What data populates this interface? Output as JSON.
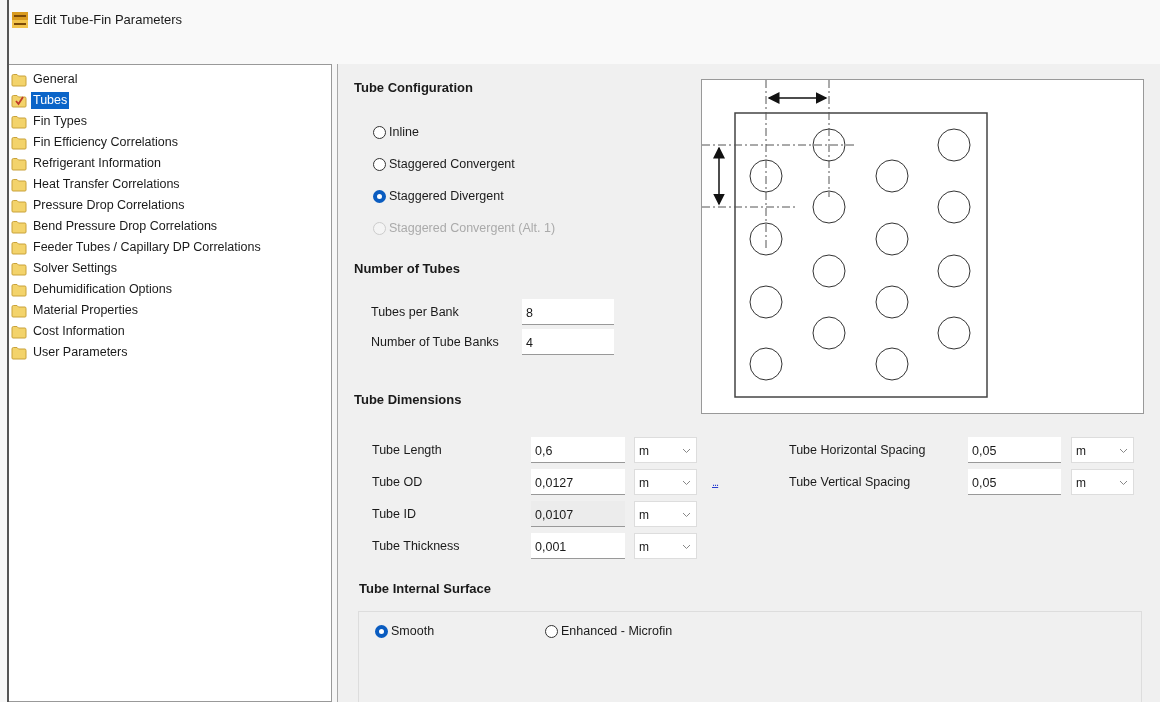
{
  "window": {
    "title": "Edit Tube-Fin Parameters"
  },
  "sidebar": {
    "items": [
      {
        "label": "General",
        "selected": false
      },
      {
        "label": "Tubes",
        "selected": true
      },
      {
        "label": "Fin Types",
        "selected": false
      },
      {
        "label": "Fin Efficiency Correlations",
        "selected": false
      },
      {
        "label": "Refrigerant Information",
        "selected": false
      },
      {
        "label": "Heat Transfer Correlations",
        "selected": false
      },
      {
        "label": "Pressure Drop Correlations",
        "selected": false
      },
      {
        "label": "Bend Pressure Drop Correlations",
        "selected": false
      },
      {
        "label": "Feeder Tubes / Capillary DP Correlations",
        "selected": false
      },
      {
        "label": "Solver Settings",
        "selected": false
      },
      {
        "label": "Dehumidification Options",
        "selected": false
      },
      {
        "label": "Material Properties",
        "selected": false
      },
      {
        "label": "Cost Information",
        "selected": false
      },
      {
        "label": "User Parameters",
        "selected": false
      }
    ]
  },
  "tube_configuration": {
    "title": "Tube Configuration",
    "options": [
      {
        "label": "Inline",
        "selected": false,
        "disabled": false
      },
      {
        "label": "Staggered Convergent",
        "selected": false,
        "disabled": false
      },
      {
        "label": "Staggered Divergent",
        "selected": true,
        "disabled": false
      },
      {
        "label": "Staggered Convergent (Alt. 1)",
        "selected": false,
        "disabled": true
      }
    ]
  },
  "number_of_tubes": {
    "title": "Number of Tubes",
    "fields": [
      {
        "label": "Tubes per Bank",
        "value": "8"
      },
      {
        "label": "Number of Tube Banks",
        "value": "4"
      }
    ]
  },
  "tube_dimensions": {
    "title": "Tube Dimensions",
    "left": [
      {
        "label": "Tube Length",
        "value": "0,6",
        "unit": "m",
        "disabled": false
      },
      {
        "label": "Tube OD",
        "value": "0,0127",
        "unit": "m",
        "disabled": false,
        "link": "..."
      },
      {
        "label": "Tube ID",
        "value": "0,0107",
        "unit": "m",
        "disabled": true
      },
      {
        "label": "Tube Thickness",
        "value": "0,001",
        "unit": "m",
        "disabled": false
      }
    ],
    "right": [
      {
        "label": "Tube Horizontal Spacing",
        "value": "0,05",
        "unit": "m",
        "disabled": false
      },
      {
        "label": "Tube Vertical Spacing",
        "value": "0,05",
        "unit": "m",
        "disabled": false
      }
    ]
  },
  "tube_internal_surface": {
    "title": "Tube Internal Surface",
    "options": [
      {
        "label": "Smooth",
        "selected": true
      },
      {
        "label": "Enhanced - Microfin",
        "selected": false
      }
    ]
  }
}
